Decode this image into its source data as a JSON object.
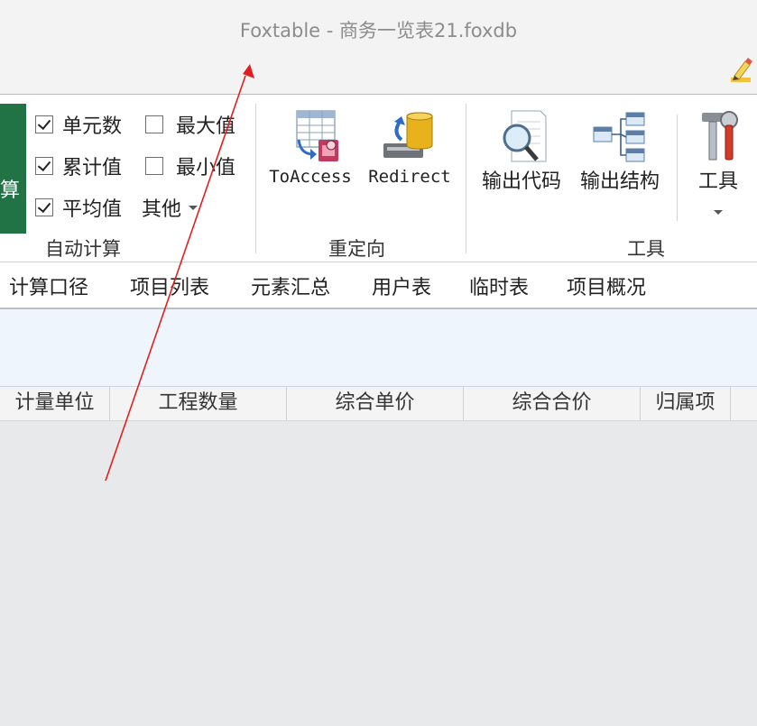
{
  "window": {
    "title": "Foxtable - 商务一览表21.foxdb"
  },
  "ribbon": {
    "auto_calc": {
      "partial_button_label": "算",
      "group_label": "自动计算",
      "items": [
        {
          "label": "单元数",
          "checked": true
        },
        {
          "label": "最大值",
          "checked": false
        },
        {
          "label": "累计值",
          "checked": true
        },
        {
          "label": "最小值",
          "checked": false
        },
        {
          "label": "平均值",
          "checked": true
        }
      ],
      "other_label": "其他"
    },
    "redirect": {
      "group_label": "重定向",
      "toaccess_label": "ToAccess",
      "redirect_label": "Redirect"
    },
    "tools": {
      "group_label": "工具",
      "export_code_label": "输出代码",
      "export_structure_label": "输出结构",
      "tools_label": "工具"
    }
  },
  "tabs": [
    "计算口径",
    "项目列表",
    "元素汇总",
    "用户表",
    "临时表",
    "项目概况"
  ],
  "table": {
    "columns": [
      "计量单位",
      "工程数量",
      "综合单价",
      "综合合价",
      "归属项"
    ]
  },
  "colors": {
    "accent_green": "#217346",
    "annotation_arrow": "#e02020",
    "title_text": "#8c8c8c"
  }
}
